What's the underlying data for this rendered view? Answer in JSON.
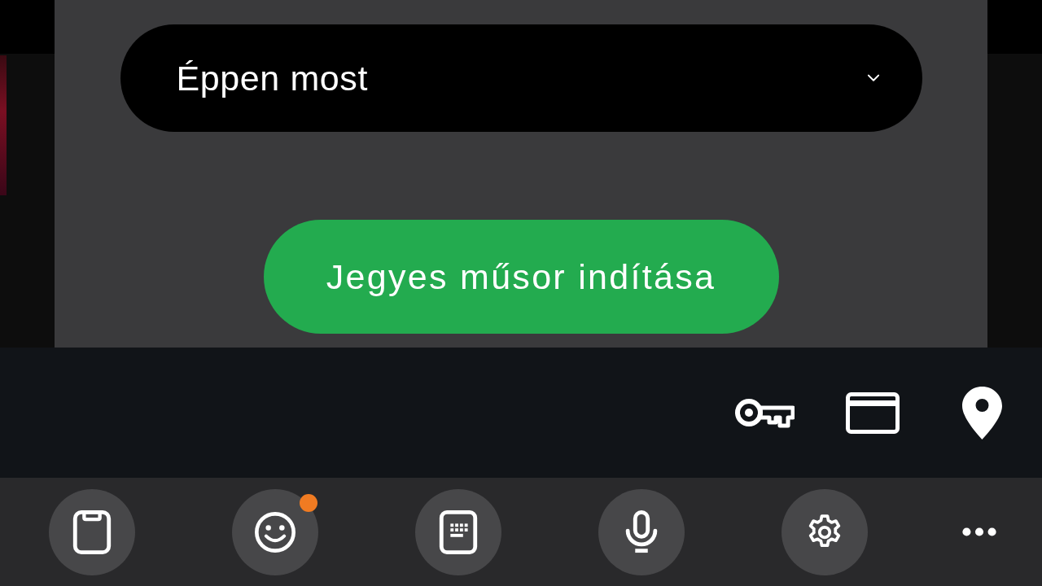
{
  "sheet": {
    "dropdown": {
      "value": "Éppen most"
    },
    "primary_button": {
      "label": "Jegyes műsor indítása"
    }
  },
  "toolbar": {
    "buttons": [
      {
        "notification": false
      },
      {
        "notification": true
      },
      {
        "notification": false
      },
      {
        "notification": false
      },
      {
        "notification": false
      }
    ]
  }
}
